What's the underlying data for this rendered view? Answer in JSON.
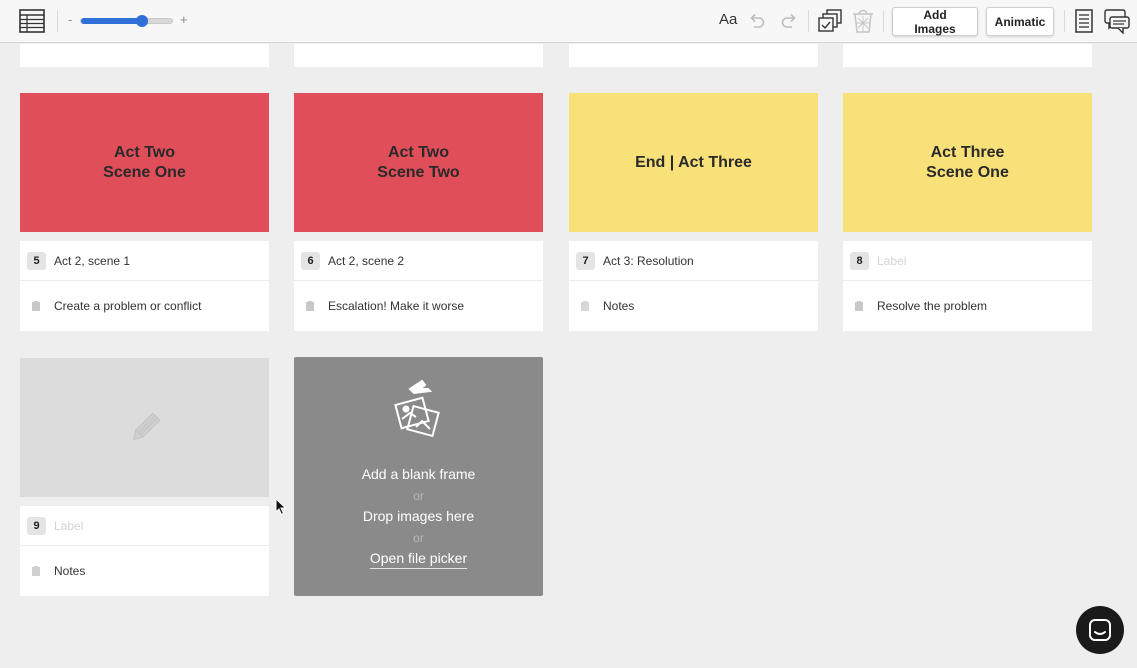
{
  "toolbar": {
    "zoom_minus": "-",
    "zoom_plus": "+",
    "zoom_level": 0.68,
    "font_toggle": "Aa",
    "add_images_label": "Add Images",
    "animatic_label": "Animatic"
  },
  "cards": [
    {
      "number": "5",
      "image_text_line1": "Act Two",
      "image_text_line2": "Scene One",
      "label": "Act 2, scene 1",
      "notes": "Create a problem or conflict",
      "color": "#e04e5a"
    },
    {
      "number": "6",
      "image_text_line1": "Act Two",
      "image_text_line2": "Scene Two",
      "label": "Act 2, scene 2",
      "notes": "Escalation! Make it worse",
      "color": "#e04e5a"
    },
    {
      "number": "7",
      "image_text_line1": "End | Act Three",
      "image_text_line2": "",
      "label": "Act 3: Resolution",
      "notes_placeholder": "Notes",
      "color": "#f9e17a"
    },
    {
      "number": "8",
      "image_text_line1": "Act Three",
      "image_text_line2": "Scene One",
      "label_placeholder": "Label",
      "notes": "Resolve the problem",
      "color": "#f9e17a"
    },
    {
      "number": "9",
      "label_placeholder": "Label",
      "notes_placeholder": "Notes",
      "color": "#dcdcdc"
    }
  ],
  "drop_zone": {
    "add_blank": "Add a blank frame",
    "or_1": "or",
    "drop_images": "Drop images here",
    "or_2": "or",
    "open_picker": "Open file picker"
  },
  "colors": {
    "accent": "#2f6fd8",
    "act_two": "#e04e5a",
    "act_three": "#f9e17a",
    "empty_frame": "#dcdcdc",
    "drop_zone": "#8a8a8a"
  }
}
